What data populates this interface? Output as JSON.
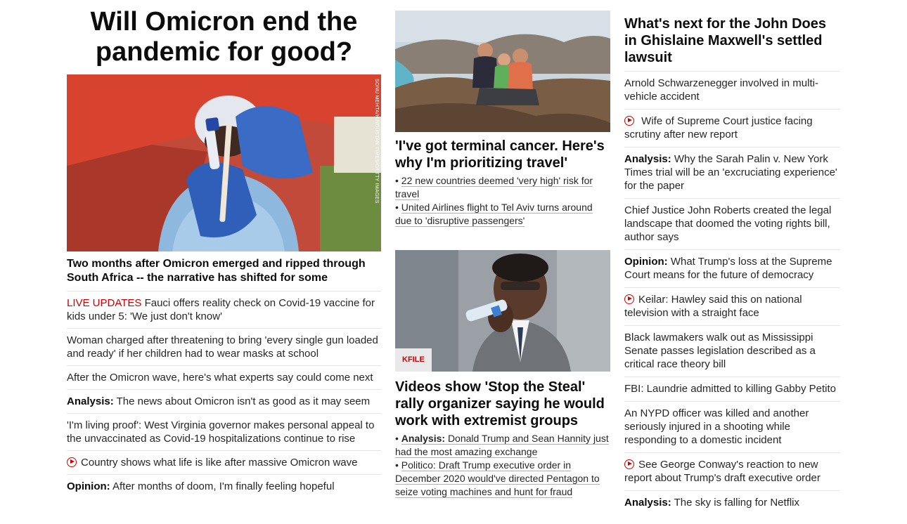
{
  "hero": {
    "title": "Will Omicron end the pandemic for good?",
    "photo_credit": "SONU MEHTA/HINDUSTAN TIMES/GETTY IMAGES",
    "caption": "Two months after Omicron emerged and ripped through South Africa -- the narrative has shifted for some"
  },
  "col1_list": [
    {
      "prefix": "LIVE UPDATES",
      "text": " Fauci offers reality check on Covid-19 vaccine for kids under 5: 'We just don't know'"
    },
    {
      "text": "Woman charged after threatening to bring 'every single gun loaded and ready' if her children had to wear masks at school"
    },
    {
      "text": "After the Omicron wave, here's what experts say could come next"
    },
    {
      "prefix": "Analysis:",
      "text": " The news about Omicron isn't as good as it may seem"
    },
    {
      "text": "'I'm living proof': West Virginia governor makes personal appeal to the unvaccinated as Covid-19 hospitalizations continue to rise"
    },
    {
      "icon": "play-icon",
      "text": "Country shows what life is like after massive Omicron wave"
    },
    {
      "prefix": "Opinion:",
      "text": " After months of doom, I'm finally feeling hopeful"
    }
  ],
  "story1": {
    "title": "'I've got terminal cancer. Here's why I'm prioritizing travel'",
    "bullets": [
      "22 new countries deemed 'very high' risk for travel",
      "United Airlines flight to Tel Aviv turns around due to 'disruptive passengers'"
    ]
  },
  "story2": {
    "badge": "KFILE",
    "title": "Videos show 'Stop the Steal' rally organizer saying he would work with extremist groups",
    "bullets": [
      {
        "prefix": "Analysis:",
        "text": "Donald Trump and Sean Hannity just had the most amazing exchange"
      },
      {
        "text": "Politico: Draft Trump executive order in December 2020 would've directed Pentagon to seize voting machines and hunt for fraud"
      }
    ]
  },
  "col3": {
    "title": "What's next for the John Does in Ghislaine Maxwell's settled lawsuit",
    "items": [
      {
        "text": "Arnold Schwarzenegger involved in multi-vehicle accident"
      },
      {
        "icon": "play-icon",
        "text": " Wife of Supreme Court justice facing scrutiny after new report"
      },
      {
        "prefix": "Analysis:",
        "text": " Why the Sarah Palin v. New York Times trial will be an 'excruciating experience' for the paper"
      },
      {
        "text": "Chief Justice John Roberts created the legal landscape that doomed the voting rights bill, author says"
      },
      {
        "prefix": "Opinion:",
        "text": " What Trump's loss at the Supreme Court means for the future of democracy"
      },
      {
        "icon": "play-icon",
        "text": "Keilar: Hawley said this on national television with a straight face"
      },
      {
        "text": "Black lawmakers walk out as Mississippi Senate passes legislation described as a critical race theory bill"
      },
      {
        "text": "FBI: Laundrie admitted to killing Gabby Petito"
      },
      {
        "text": "An NYPD officer was killed and another seriously injured in a shooting while responding to a domestic incident"
      },
      {
        "icon": "play-icon",
        "text": "See George Conway's reaction to new report about Trump's draft executive order"
      },
      {
        "prefix": "Analysis:",
        "text": " The sky is falling for Netflix"
      }
    ]
  },
  "colors": {
    "accent": "#cc0000",
    "text": "#262626",
    "divider": "#e6e6e6"
  }
}
